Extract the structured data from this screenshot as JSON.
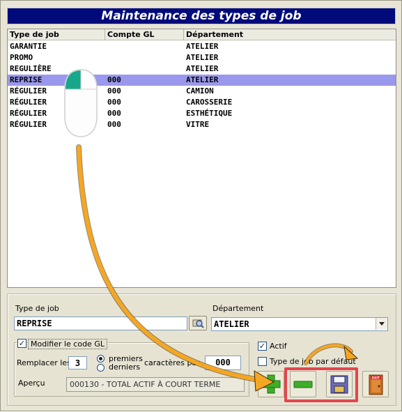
{
  "window": {
    "title": "Maintenance des types de job"
  },
  "list": {
    "columns": [
      "Type de job",
      "Compte GL",
      "Département"
    ],
    "rows": [
      {
        "type": "GARANTIE",
        "compte": "",
        "dept": "ATELIER",
        "selected": false
      },
      {
        "type": "PROMO",
        "compte": "",
        "dept": "ATELIER",
        "selected": false
      },
      {
        "type": "REGULIÈRE",
        "compte": "",
        "dept": "ATELIER",
        "selected": false
      },
      {
        "type": "REPRISE",
        "compte": "000",
        "dept": "ATELIER",
        "selected": true
      },
      {
        "type": "RÉGULIER",
        "compte": "000",
        "dept": "CAMION",
        "selected": false
      },
      {
        "type": "RÉGULIER",
        "compte": "000",
        "dept": "CAROSSERIE",
        "selected": false
      },
      {
        "type": "RÉGULIER",
        "compte": "000",
        "dept": "ESTHÉTIQUE",
        "selected": false
      },
      {
        "type": "RÉGULIER",
        "compte": "000",
        "dept": "VITRE",
        "selected": false
      }
    ]
  },
  "form": {
    "type_label": "Type de job",
    "type_value": "REPRISE",
    "dept_label": "Département",
    "dept_value": "ATELIER",
    "modifier_label": "Modifier le code GL",
    "modifier_checked": true,
    "remplacer_label": "Remplacer les",
    "remplacer_value": "3",
    "radio_premiers": "premiers",
    "radio_derniers": "derniers",
    "caracteres_label": "caractères par",
    "caracteres_value": "000",
    "apercu_label": "Aperçu",
    "apercu_value": "000130 - TOTAL ACTIF À COURT TERME",
    "actif_label": "Actif",
    "actif_checked": true,
    "defaut_label": "Type de job par défaut",
    "defaut_checked": false
  },
  "toolbar": {
    "exit_label": "EXIT",
    "icons": [
      "add-icon",
      "remove-icon",
      "save-icon",
      "exit-door-icon"
    ]
  },
  "colors": {
    "title_bg": "#000a7b",
    "selected_row": "#9a98ec",
    "highlight": "#e4464d",
    "arrow": "#f5a623"
  }
}
